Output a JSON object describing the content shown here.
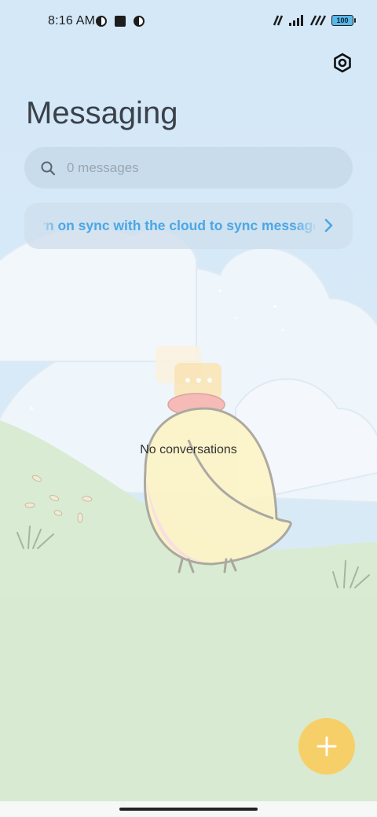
{
  "status_bar": {
    "time": "8:16 AM",
    "battery_level": "100"
  },
  "header": {
    "title": "Messaging",
    "settings_icon": "settings-hexagon-icon"
  },
  "search": {
    "placeholder": "0 messages",
    "icon": "search-icon"
  },
  "sync_banner": {
    "text": "Turn on sync with the cloud to sync messages",
    "icon": "chevron-right-icon"
  },
  "empty_state": {
    "label": "No conversations",
    "illustration": "chick-illustration"
  },
  "fab": {
    "icon": "plus-icon"
  },
  "colors": {
    "sky": "#d6e9f7",
    "grass": "#d8ead2",
    "accent_blue": "#4aa7e6",
    "fab": "#f7cf68"
  }
}
